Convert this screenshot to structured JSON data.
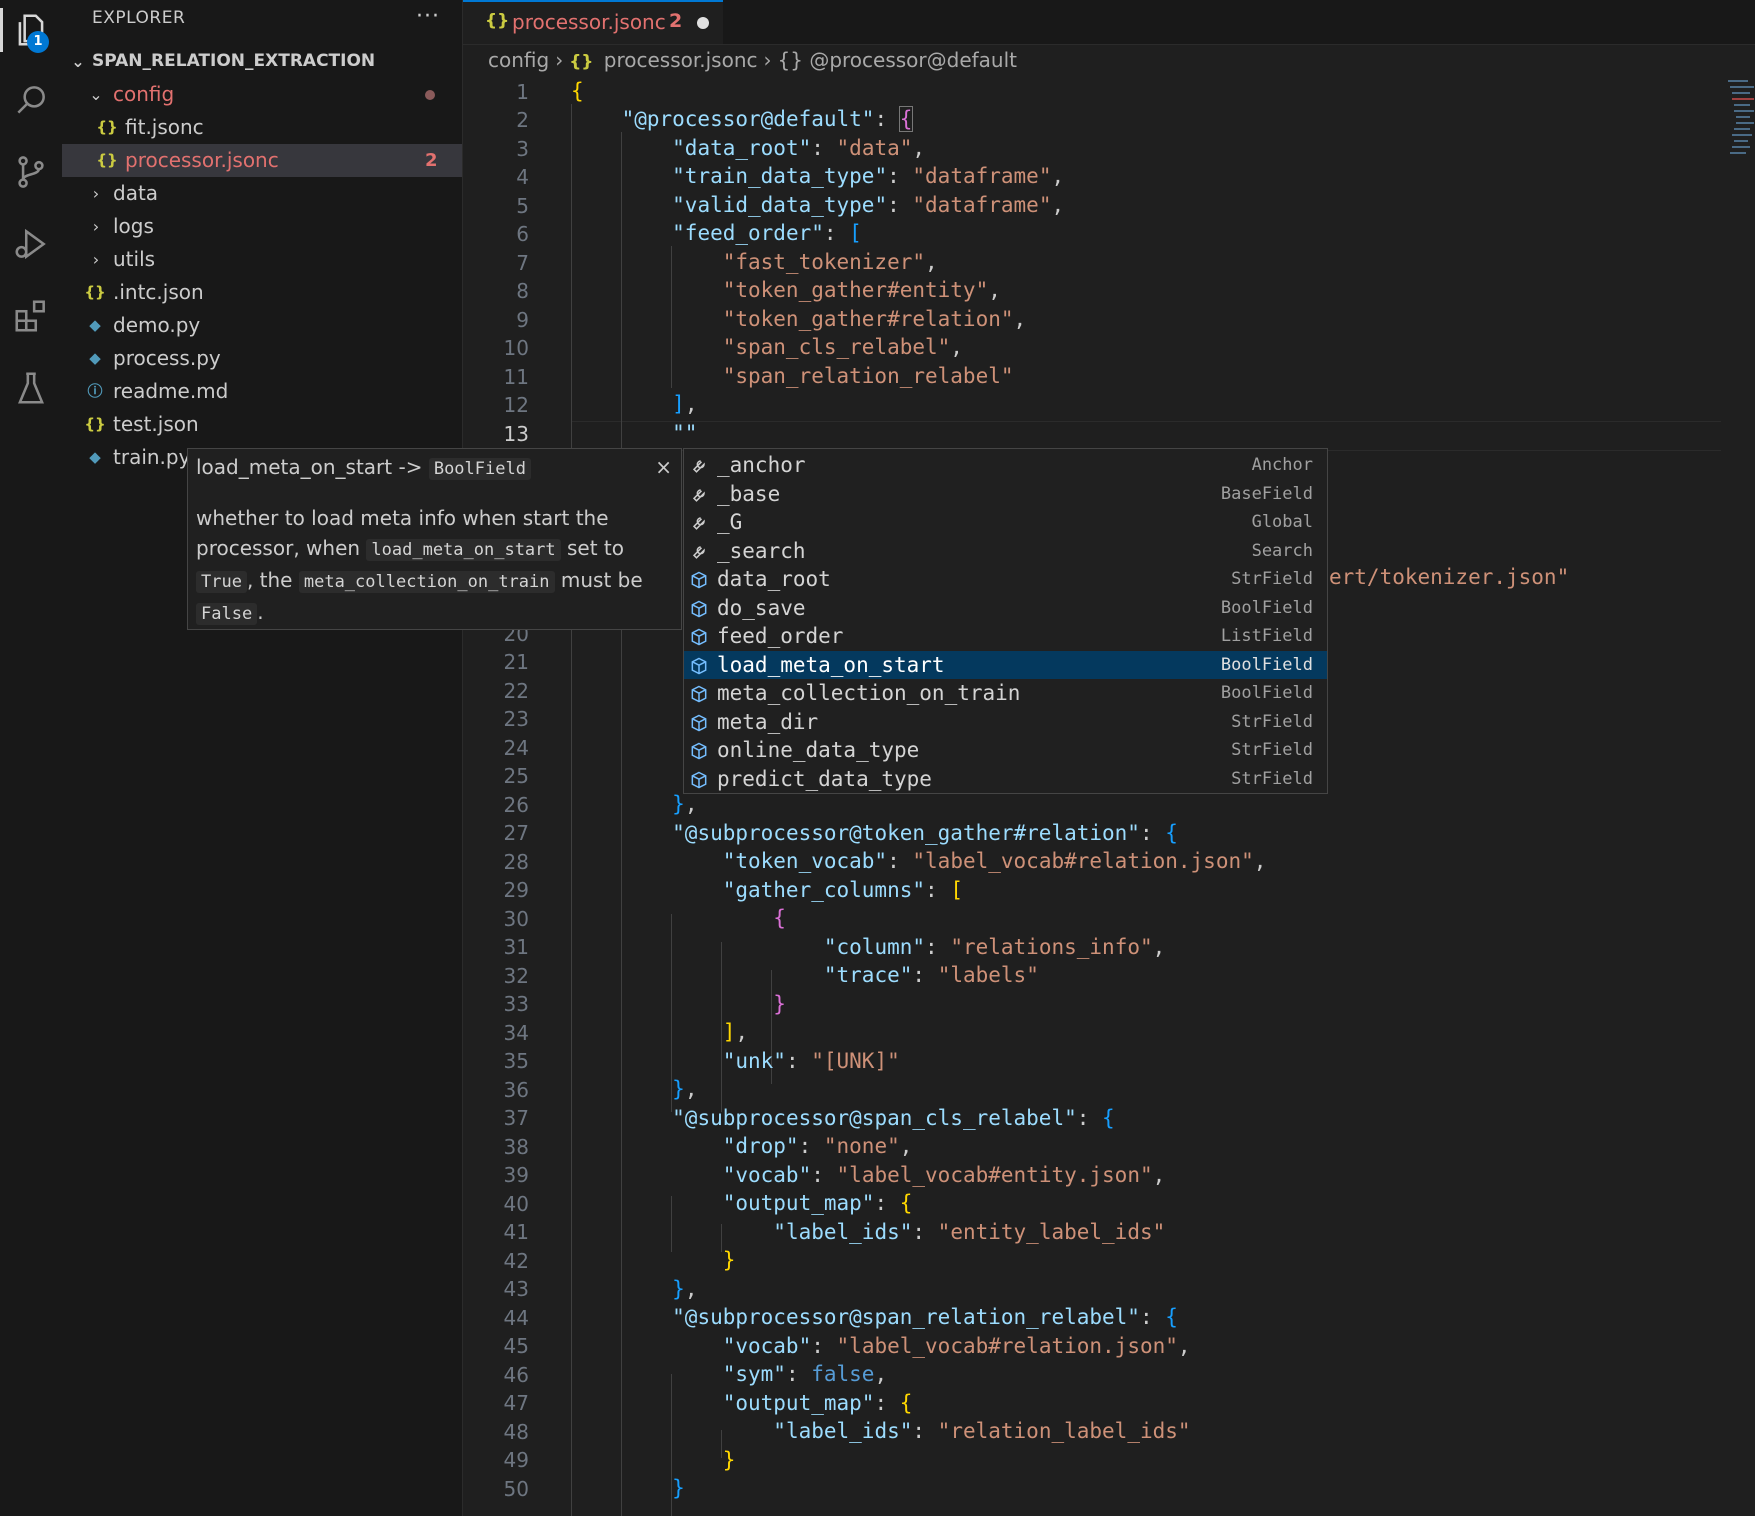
{
  "activity_bar": {
    "explorer_badge": "1"
  },
  "sidebar": {
    "title": "EXPLORER",
    "more": "···",
    "project": "SPAN_RELATION_EXTRACTION",
    "items": [
      {
        "label": "config",
        "kind": "folder-open"
      },
      {
        "label": "fit.jsonc",
        "kind": "json"
      },
      {
        "label": "processor.jsonc",
        "kind": "json",
        "problems": "2"
      },
      {
        "label": "data",
        "kind": "folder"
      },
      {
        "label": "logs",
        "kind": "folder"
      },
      {
        "label": "utils",
        "kind": "folder"
      },
      {
        "label": ".intc.json",
        "kind": "json"
      },
      {
        "label": "demo.py",
        "kind": "python"
      },
      {
        "label": "process.py",
        "kind": "python"
      },
      {
        "label": "readme.md",
        "kind": "info"
      },
      {
        "label": "test.json",
        "kind": "json"
      },
      {
        "label": "train.py",
        "kind": "python"
      }
    ]
  },
  "tab": {
    "name": "processor.jsonc",
    "problems": "2"
  },
  "breadcrumb": {
    "folder": "config",
    "file": "processor.jsonc",
    "symbol": "{} @processor@default"
  },
  "editor": {
    "line_numbers": [
      "1",
      "2",
      "3",
      "4",
      "5",
      "6",
      "7",
      "8",
      "9",
      "10",
      "11",
      "12",
      "13",
      "20",
      "21",
      "22",
      "23",
      "24",
      "25",
      "26",
      "27",
      "28",
      "29",
      "30",
      "31",
      "32",
      "33",
      "34",
      "35",
      "36",
      "37",
      "38",
      "39",
      "40",
      "41",
      "42",
      "43",
      "44",
      "45",
      "46",
      "47",
      "48",
      "49",
      "50"
    ],
    "hidden_fragment": "ert/tokenizer.json\""
  },
  "suggest": {
    "items": [
      {
        "label": "_anchor",
        "type": "Anchor",
        "icon": "wrench-icon"
      },
      {
        "label": "_base",
        "type": "BaseField",
        "icon": "wrench-icon"
      },
      {
        "label": "_G",
        "type": "Global",
        "icon": "wrench-icon"
      },
      {
        "label": "_search",
        "type": "Search",
        "icon": "wrench-icon"
      },
      {
        "label": "data_root",
        "type": "StrField",
        "icon": "cube-icon"
      },
      {
        "label": "do_save",
        "type": "BoolField",
        "icon": "cube-icon"
      },
      {
        "label": "feed_order",
        "type": "ListField",
        "icon": "cube-icon"
      },
      {
        "label": "load_meta_on_start",
        "type": "BoolField",
        "icon": "cube-icon",
        "selected": true
      },
      {
        "label": "meta_collection_on_train",
        "type": "BoolField",
        "icon": "cube-icon"
      },
      {
        "label": "meta_dir",
        "type": "StrField",
        "icon": "cube-icon"
      },
      {
        "label": "online_data_type",
        "type": "StrField",
        "icon": "cube-icon"
      },
      {
        "label": "predict_data_type",
        "type": "StrField",
        "icon": "cube-icon"
      }
    ]
  },
  "details": {
    "title_name": "load_meta_on_start ->",
    "title_type": "BoolField",
    "close": "×",
    "desc": {
      "t1": "whether to load meta info when start the processor, when",
      "c1": "load_meta_on_start",
      "t2": "set to",
      "c2": "True",
      "t3": ", the",
      "c3": "meta_collection_on_train",
      "t4": "must be",
      "c4": "False",
      "t5": "."
    }
  }
}
